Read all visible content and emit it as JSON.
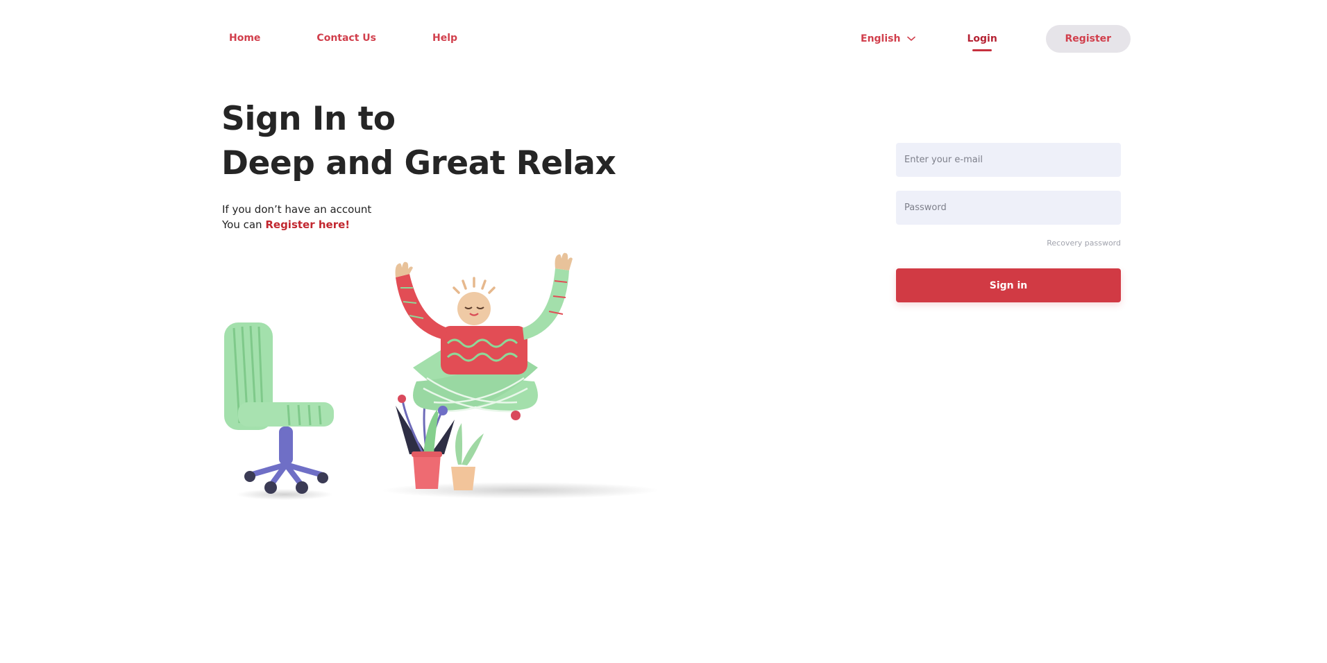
{
  "nav": {
    "links": [
      {
        "label": "Home"
      },
      {
        "label": "Contact Us"
      },
      {
        "label": "Help"
      }
    ],
    "language": "English",
    "login_label": "Login",
    "register_label": "Register"
  },
  "hero": {
    "title_line1": "Sign In to",
    "title_line2": "Deep and Great Relax",
    "subtitle_line1": "If you don’t have an account",
    "subtitle_line2_prefix": "You can ",
    "register_link": "Register here!"
  },
  "form": {
    "email_placeholder": "Enter your e-mail",
    "password_placeholder": "Password",
    "recovery_label": "Recovery password",
    "signin_label": "Sign in"
  },
  "colors": {
    "accent": "#d13a44",
    "link": "#d13f4c",
    "input_bg": "#eef0f9",
    "register_bg": "#e6e4e9"
  },
  "icons": {
    "language_dropdown": "chevron-down-icon"
  }
}
